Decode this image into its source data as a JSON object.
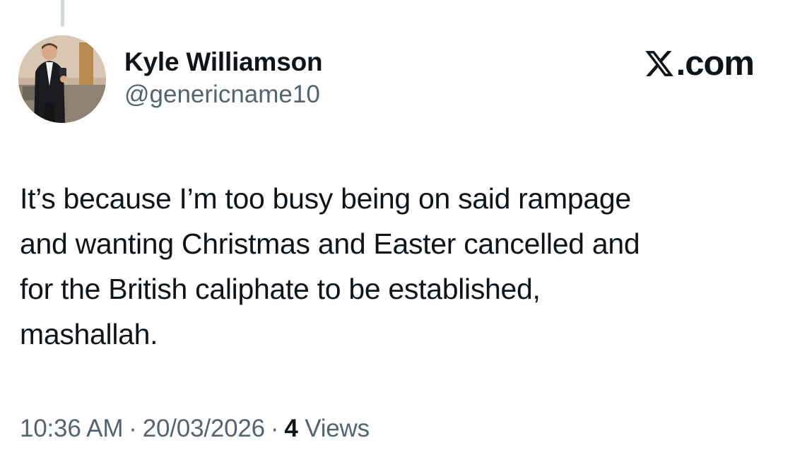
{
  "tweet": {
    "author": {
      "display_name": "Kyle Williamson",
      "handle": "@genericname10",
      "avatar": "profile-photo"
    },
    "brand": {
      "icon": "x-logo-icon",
      "text": ".com"
    },
    "text_lines": [
      "It’s because I’m too busy being on said rampage",
      "and wanting Christmas and Easter cancelled and",
      "for the British caliphate to be established,",
      "mashallah."
    ],
    "meta": {
      "time": "10:36 AM",
      "separator": "·",
      "date": "20/03/2026",
      "views_count": "4",
      "views_label": "Views"
    }
  },
  "colors": {
    "primary_text": "#0f1419",
    "secondary_text": "#536471",
    "thread_line": "#cfd9de"
  }
}
